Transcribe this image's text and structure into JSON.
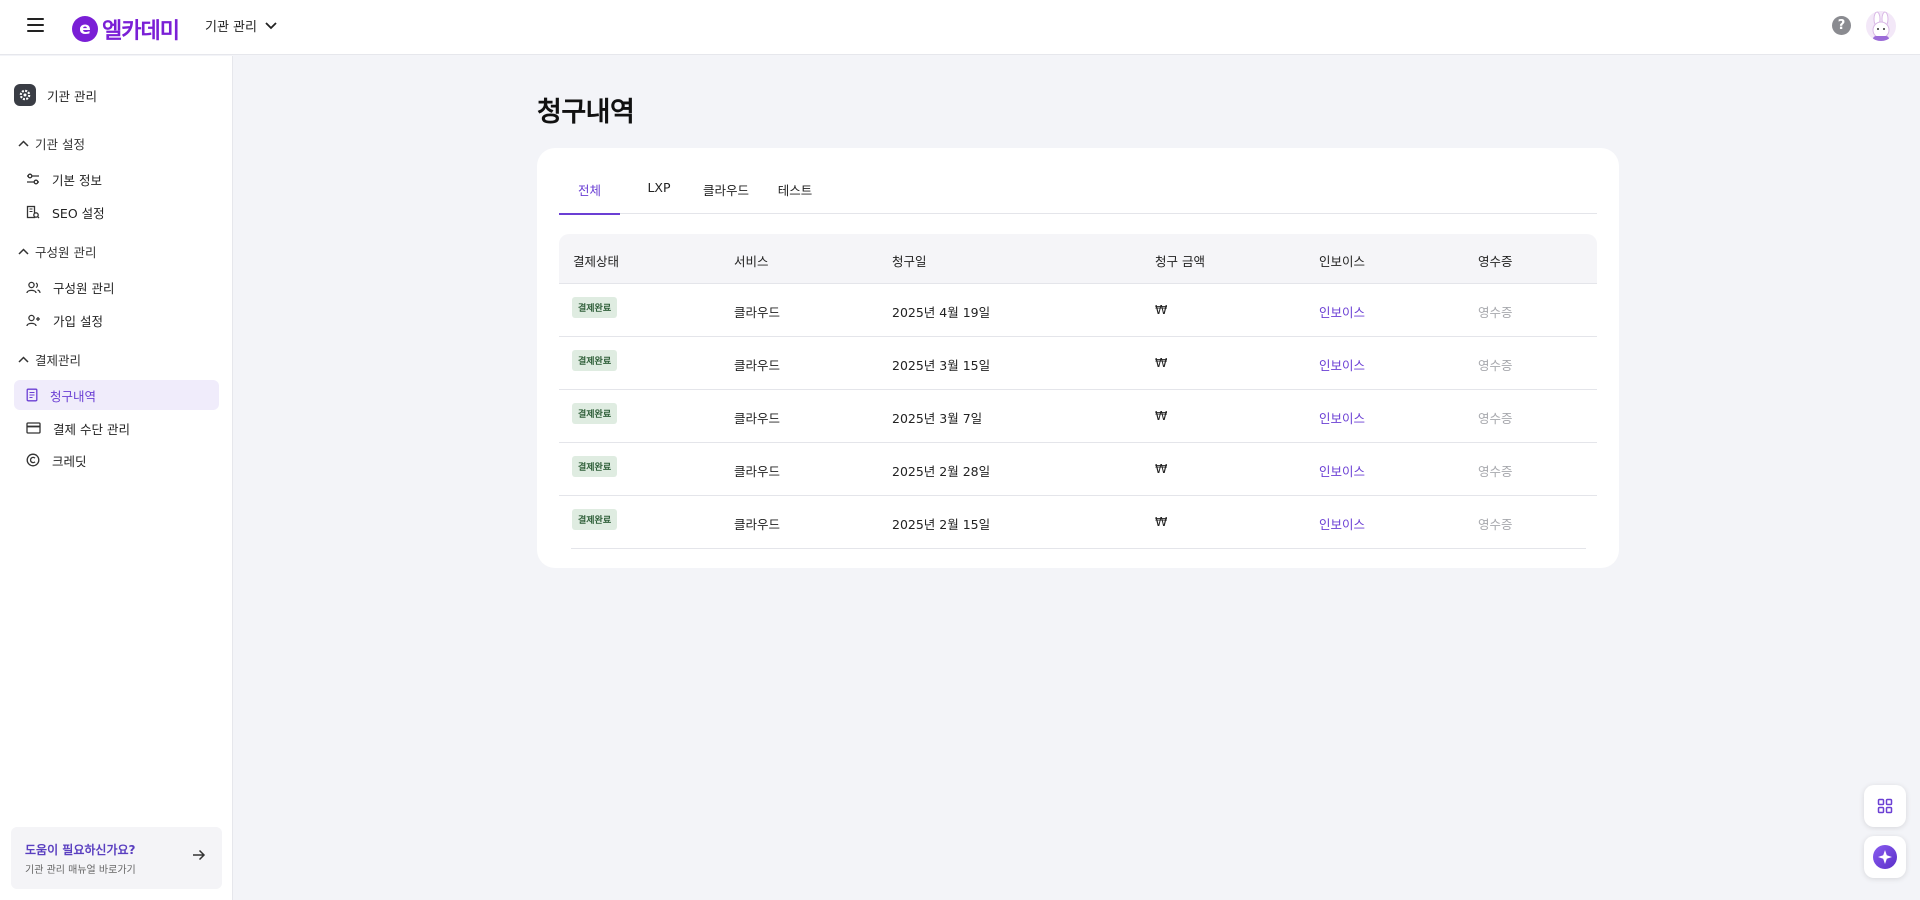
{
  "header": {
    "logo_mark": "e",
    "logo_text": "엘카데미",
    "org_selector": "기관 관리"
  },
  "sidebar": {
    "org_label": "기관 관리",
    "sections": [
      {
        "label": "기관 설정",
        "items": [
          {
            "label": "기본 정보",
            "icon": "sliders-icon"
          },
          {
            "label": "SEO 설정",
            "icon": "seo-icon"
          }
        ]
      },
      {
        "label": "구성원 관리",
        "items": [
          {
            "label": "구성원 관리",
            "icon": "users-icon"
          },
          {
            "label": "가입 설정",
            "icon": "user-plus-icon"
          }
        ]
      },
      {
        "label": "결제관리",
        "items": [
          {
            "label": "청구내역",
            "icon": "document-icon",
            "active": true
          },
          {
            "label": "결제 수단 관리",
            "icon": "card-icon"
          },
          {
            "label": "크레딧",
            "icon": "copyright-icon"
          }
        ]
      }
    ],
    "help": {
      "title": "도움이 필요하신가요?",
      "subtitle": "기관 관리 매뉴얼 바로가기"
    }
  },
  "main": {
    "title": "청구내역",
    "tabs": [
      "전체",
      "LXP",
      "클라우드",
      "테스트"
    ],
    "active_tab": "전체",
    "table": {
      "headers": [
        "결제상태",
        "서비스",
        "청구일",
        "청구 금액",
        "인보이스",
        "영수증"
      ],
      "rows": [
        {
          "status": "결제완료",
          "service": "클라우드",
          "date": "2025년 4월 19일",
          "amount": "₩",
          "invoice": "인보이스",
          "receipt": "영수증"
        },
        {
          "status": "결제완료",
          "service": "클라우드",
          "date": "2025년 3월 15일",
          "amount": "₩",
          "invoice": "인보이스",
          "receipt": "영수증"
        },
        {
          "status": "결제완료",
          "service": "클라우드",
          "date": "2025년 3월 7일",
          "amount": "₩",
          "invoice": "인보이스",
          "receipt": "영수증"
        },
        {
          "status": "결제완료",
          "service": "클라우드",
          "date": "2025년 2월 28일",
          "amount": "₩",
          "invoice": "인보이스",
          "receipt": "영수증"
        },
        {
          "status": "결제완료",
          "service": "클라우드",
          "date": "2025년 2월 15일",
          "amount": "₩",
          "invoice": "인보이스",
          "receipt": "영수증"
        }
      ]
    }
  },
  "colors": {
    "accent": "#6b3fd4",
    "brand": "#7a1fd6",
    "status_badge_bg": "#dfece1",
    "status_badge_text": "#2e5e38"
  }
}
